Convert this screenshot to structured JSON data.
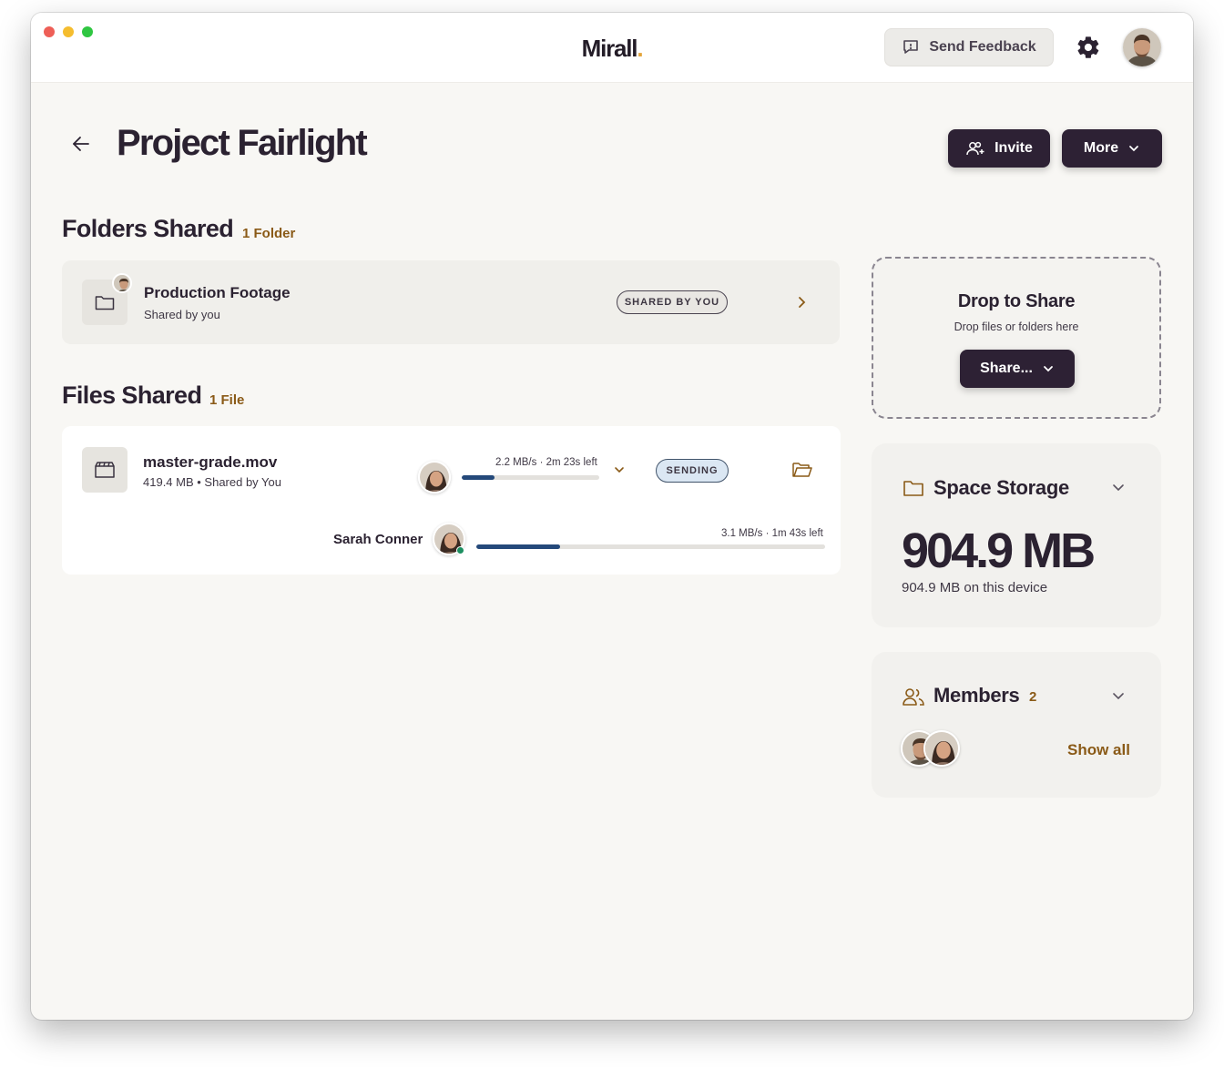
{
  "header": {
    "app_name": "Mirall",
    "logo_dot": ".",
    "feedback_label": "Send Feedback"
  },
  "page": {
    "title": "Project Fairlight",
    "invite_label": "Invite",
    "more_label": "More"
  },
  "folders": {
    "title": "Folders Shared",
    "count": "1 Folder",
    "items": [
      {
        "name": "Production Footage",
        "sub": "Shared by you",
        "badge": "SHARED BY YOU"
      }
    ]
  },
  "files": {
    "title": "Files Shared",
    "count": "1 File",
    "items": [
      {
        "name": "master-grade.mov",
        "sub": "419.4 MB • Shared by You",
        "rate": "2.2 MB/s · 2m 23s left",
        "progress": 0.24,
        "badge": "SENDING",
        "recipients": [
          {
            "name": "Sarah Conner",
            "rate": "3.1 MB/s · 1m 43s left",
            "progress": 0.24,
            "online": true
          }
        ]
      }
    ]
  },
  "drop": {
    "title": "Drop to Share",
    "subtitle": "Drop files or folders here",
    "share_label": "Share..."
  },
  "storage": {
    "title": "Space Storage",
    "value": "904.9 MB",
    "subtitle": "904.9 MB on this device"
  },
  "members": {
    "title": "Members",
    "count": "2",
    "show_all_label": "Show all"
  },
  "colors": {
    "accent": "#8a5a17",
    "primary": "#2d2134",
    "progress": "#24497a"
  }
}
